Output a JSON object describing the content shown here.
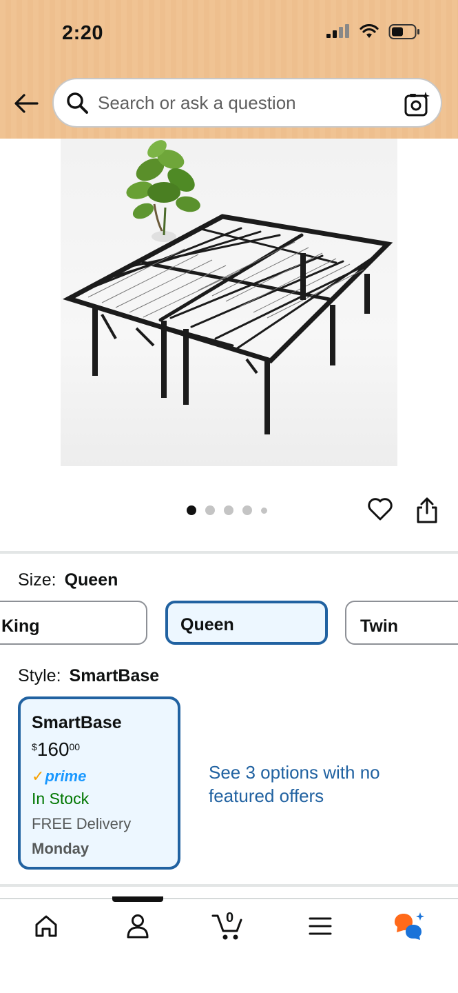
{
  "status_bar": {
    "time": "2:20"
  },
  "search": {
    "placeholder": "Search or ask a question"
  },
  "gallery": {
    "image_count": 5,
    "active_index": 0
  },
  "size": {
    "label": "Size:",
    "selected": "Queen",
    "options": [
      "King",
      "Queen",
      "Twin"
    ]
  },
  "style": {
    "label": "Style:",
    "selected": "SmartBase",
    "card": {
      "title": "SmartBase",
      "currency": "$",
      "price_whole": "160",
      "price_fraction": "00",
      "prime": "prime",
      "availability": "In Stock",
      "delivery": "FREE Delivery",
      "delivery_day": "Monday"
    },
    "options_link": "See 3 options with no featured offers"
  },
  "bottom_nav": {
    "cart_count": "0",
    "items": [
      "home-icon",
      "account-icon",
      "cart-icon",
      "menu-icon",
      "rufus-icon"
    ]
  },
  "colors": {
    "header": "#f0c393",
    "selected_border": "#2162a1",
    "selected_bg": "#edf7ff",
    "link": "#2162a1",
    "in_stock": "#007600",
    "prime": "#1a98ff",
    "prime_check": "#f7a000"
  }
}
